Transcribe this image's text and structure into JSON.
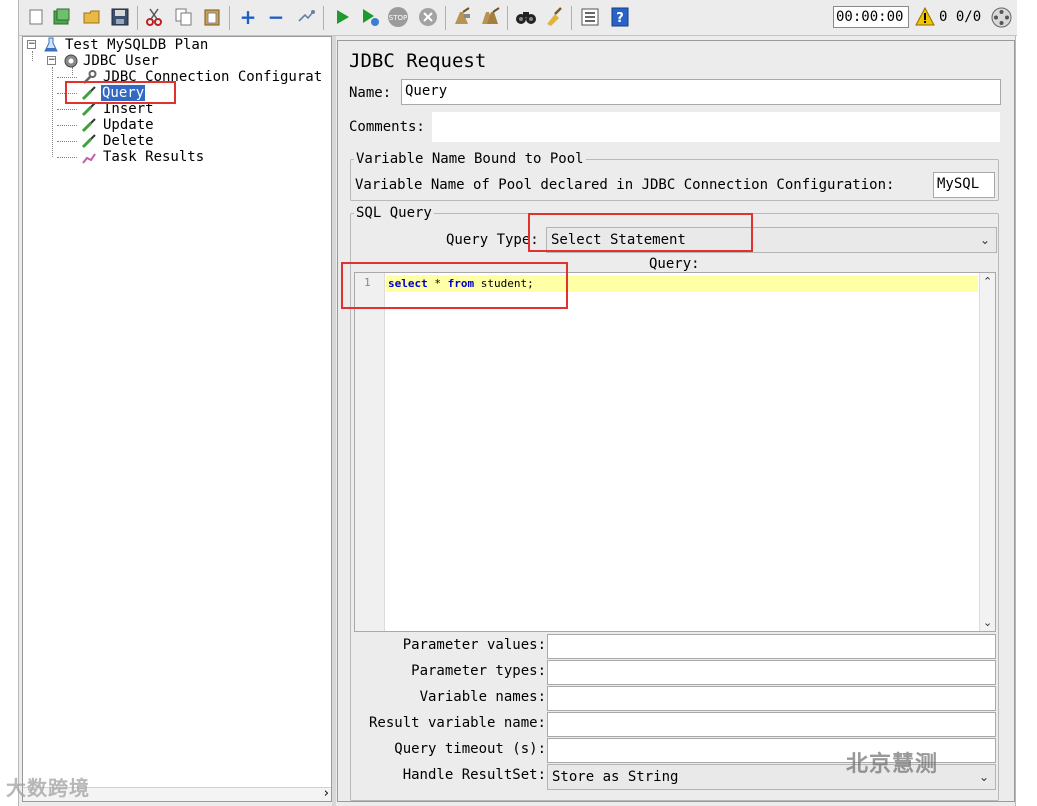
{
  "toolbar": {
    "buttons": [
      {
        "name": "new-icon",
        "glyph": "▫"
      },
      {
        "name": "templates-icon",
        "glyph": "▤"
      },
      {
        "name": "open-icon",
        "glyph": "▣"
      },
      {
        "name": "save-icon",
        "glyph": "▪"
      },
      {
        "name": "cut-icon",
        "glyph": "✂"
      },
      {
        "name": "copy-icon",
        "glyph": "⎘"
      },
      {
        "name": "paste-icon",
        "glyph": "▦"
      },
      {
        "name": "expand-icon",
        "glyph": "+"
      },
      {
        "name": "collapse-icon",
        "glyph": "−"
      },
      {
        "name": "toggle-icon",
        "glyph": "↯"
      },
      {
        "name": "start-icon",
        "glyph": "▶"
      },
      {
        "name": "start-no-pauses-icon",
        "glyph": "▶"
      },
      {
        "name": "stop-icon",
        "glyph": "●"
      },
      {
        "name": "shutdown-icon",
        "glyph": "●"
      },
      {
        "name": "clear-icon",
        "glyph": "✎"
      },
      {
        "name": "clear-all-icon",
        "glyph": "✎"
      },
      {
        "name": "search-icon",
        "glyph": "⚲"
      },
      {
        "name": "reset-search-icon",
        "glyph": "✦"
      },
      {
        "name": "function-helper-icon",
        "glyph": "☰"
      },
      {
        "name": "help-icon",
        "glyph": "?"
      }
    ],
    "timer": "00:00:00",
    "warning_count": "0",
    "threads": "0/0"
  },
  "tree": {
    "root": "Test MySQLDB Plan",
    "thread_group": "JDBC User",
    "children": [
      {
        "label": "JDBC Connection Configurat",
        "icon": "wrench-icon"
      },
      {
        "label": "Query",
        "icon": "pipette-icon"
      },
      {
        "label": "Insert",
        "icon": "pipette-icon"
      },
      {
        "label": "Update",
        "icon": "pipette-icon"
      },
      {
        "label": "Delete",
        "icon": "pipette-icon"
      },
      {
        "label": "Task Results",
        "icon": "graph-icon"
      }
    ]
  },
  "panel": {
    "title": "JDBC Request",
    "name_label": "Name:",
    "name_value": "Query",
    "comments_label": "Comments:",
    "comments_value": "",
    "pool_group_title": "Variable Name Bound to Pool",
    "pool_label": "Variable Name of Pool declared in JDBC Connection Configuration:",
    "pool_value": "MySQL",
    "sql_group_title": "SQL Query",
    "query_type_label": "Query Type:",
    "query_type_value": "Select Statement",
    "query_label": "Query:",
    "line_number": "1",
    "code": {
      "kw1": "select",
      "op": " * ",
      "kw2": "from",
      "rest": " student;"
    },
    "params": [
      {
        "label": "Parameter values:",
        "value": ""
      },
      {
        "label": "Parameter types:",
        "value": ""
      },
      {
        "label": "Variable names:",
        "value": ""
      },
      {
        "label": "Result variable name:",
        "value": ""
      },
      {
        "label": "Query timeout (s):",
        "value": ""
      }
    ],
    "handle_label": "Handle ResultSet:",
    "handle_value": "Store as String"
  },
  "watermarks": {
    "left": "大数跨境",
    "right": "北京慧测"
  },
  "colors": {
    "annotation": "#e2322f",
    "selection": "#316ac5",
    "highlight_line": "#ffffa6"
  }
}
